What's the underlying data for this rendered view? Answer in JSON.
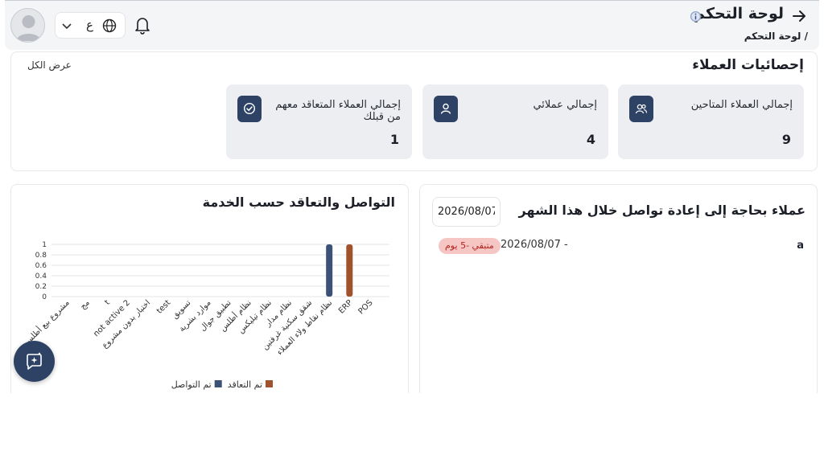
{
  "header": {
    "title": "لوحة التحكم",
    "breadcrumb": "/ لوحة التحكم",
    "language": "ع"
  },
  "stats": {
    "title": "إحصائيات العملاء",
    "view_all": "عرض الكل",
    "cards": [
      {
        "label": "إجمالي العملاء المتاحين",
        "value": "9",
        "icon": "users-icon"
      },
      {
        "label": "إجمالي عملائي",
        "value": "4",
        "icon": "user-icon"
      },
      {
        "label": "إجمالي العملاء المتعاقد معهم من قبلك",
        "value": "1",
        "icon": "check-circle-icon"
      }
    ]
  },
  "reconnect": {
    "title": "عملاء بحاجة إلى إعادة تواصل خلال هذا الشهر",
    "date_value": "2026/08/07",
    "items": [
      {
        "name": "a",
        "date": "2026/08/07 -",
        "badge": "متبقي -5 يوم"
      }
    ]
  },
  "chart_data": {
    "type": "bar",
    "title": "التواصل والتعاقد حسب الخدمة",
    "categories": [
      "POS",
      "ERP",
      "نظام نقاط ولاء العملاء",
      "شقق سكنية غرفتين",
      "نظام مدار",
      "نظام تيليكس",
      "نظام أطلس",
      "تطبيق جوال",
      "موارد بشرية",
      "تسويق",
      "test",
      "اختبار بدون مشروع",
      "not active 2",
      "t",
      "مج",
      "مشروع بيع أطلس"
    ],
    "series": [
      {
        "name": "تم التعاقد",
        "color": "#a0522d",
        "values": [
          0,
          1,
          0,
          0,
          0,
          0,
          0,
          0,
          0,
          0,
          0,
          0,
          0,
          0,
          0,
          0
        ]
      },
      {
        "name": "تم التواصل",
        "color": "#3b5175",
        "values": [
          0,
          0,
          1,
          0,
          0,
          0,
          0,
          0,
          0,
          0,
          0,
          0,
          0,
          0,
          0,
          0
        ]
      }
    ],
    "yticks": [
      "0",
      "0.2",
      "0.4",
      "0.6",
      "0.8",
      "1"
    ],
    "ylim": [
      0,
      1
    ],
    "grid": true,
    "legend_position": "bottom"
  }
}
